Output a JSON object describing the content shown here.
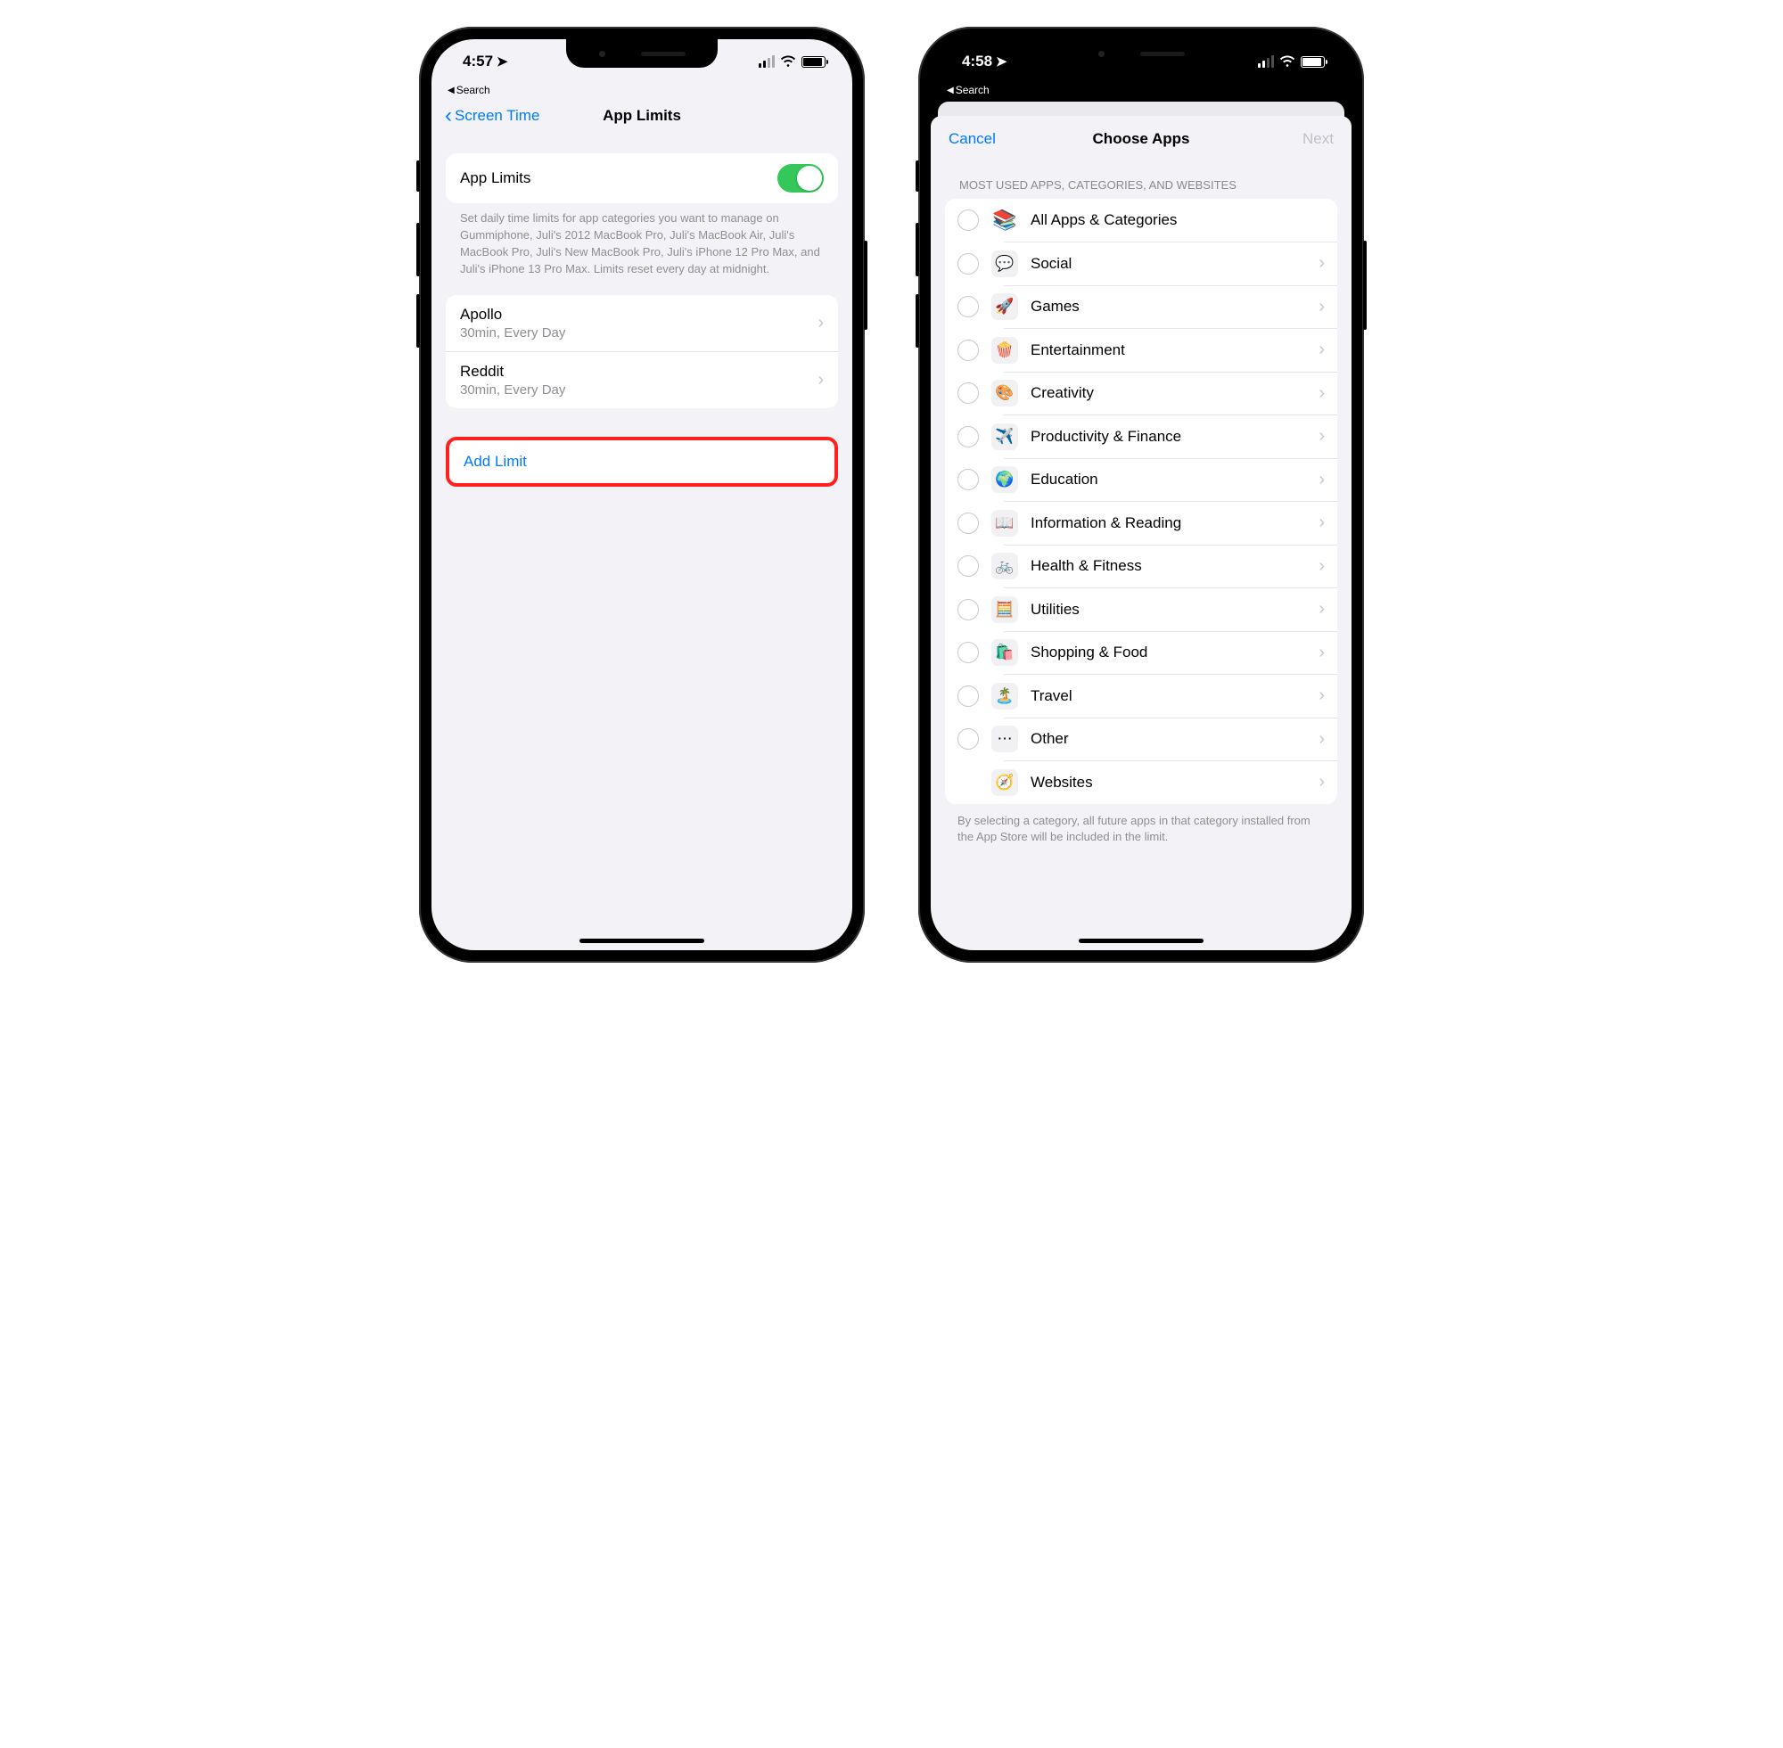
{
  "left": {
    "status": {
      "time": "4:57",
      "breadcrumb": "Search"
    },
    "nav": {
      "back": "Screen Time",
      "title": "App Limits"
    },
    "toggle_row": {
      "label": "App Limits",
      "on": true
    },
    "description": "Set daily time limits for app categories you want to manage on Gummiphone, Juli's 2012 MacBook Pro, Juli's MacBook Air, Juli's MacBook Pro, Juli's New MacBook Pro, Juli's iPhone 12 Pro Max, and Juli's iPhone 13 Pro Max. Limits reset every day at midnight.",
    "limits": [
      {
        "name": "Apollo",
        "detail": "30min, Every Day"
      },
      {
        "name": "Reddit",
        "detail": "30min, Every Day"
      }
    ],
    "add_button": "Add Limit"
  },
  "right": {
    "status": {
      "time": "4:58",
      "breadcrumb": "Search"
    },
    "sheet": {
      "cancel": "Cancel",
      "title": "Choose Apps",
      "next": "Next",
      "section_header": "MOST USED APPS, CATEGORIES, AND WEBSITES",
      "categories": [
        {
          "id": "all",
          "label": "All Apps & Categories",
          "icon": "📚",
          "radio": true,
          "chevron": false
        },
        {
          "id": "social",
          "label": "Social",
          "icon": "💬",
          "radio": true,
          "chevron": true
        },
        {
          "id": "games",
          "label": "Games",
          "icon": "🚀",
          "radio": true,
          "chevron": true
        },
        {
          "id": "entertainment",
          "label": "Entertainment",
          "icon": "🍿",
          "radio": true,
          "chevron": true
        },
        {
          "id": "creativity",
          "label": "Creativity",
          "icon": "🎨",
          "radio": true,
          "chevron": true
        },
        {
          "id": "productivity",
          "label": "Productivity & Finance",
          "icon": "✈️",
          "radio": true,
          "chevron": true
        },
        {
          "id": "education",
          "label": "Education",
          "icon": "🌍",
          "radio": true,
          "chevron": true
        },
        {
          "id": "info",
          "label": "Information & Reading",
          "icon": "📖",
          "radio": true,
          "chevron": true
        },
        {
          "id": "health",
          "label": "Health & Fitness",
          "icon": "🚲",
          "radio": true,
          "chevron": true
        },
        {
          "id": "utilities",
          "label": "Utilities",
          "icon": "🧮",
          "radio": true,
          "chevron": true
        },
        {
          "id": "shopping",
          "label": "Shopping & Food",
          "icon": "🛍️",
          "radio": true,
          "chevron": true
        },
        {
          "id": "travel",
          "label": "Travel",
          "icon": "🏝️",
          "radio": true,
          "chevron": true
        },
        {
          "id": "other",
          "label": "Other",
          "icon": "⋯",
          "radio": true,
          "chevron": true
        },
        {
          "id": "websites",
          "label": "Websites",
          "icon": "🧭",
          "radio": false,
          "chevron": true
        }
      ],
      "footer": "By selecting a category, all future apps in that category installed from the App Store will be included in the limit."
    }
  }
}
